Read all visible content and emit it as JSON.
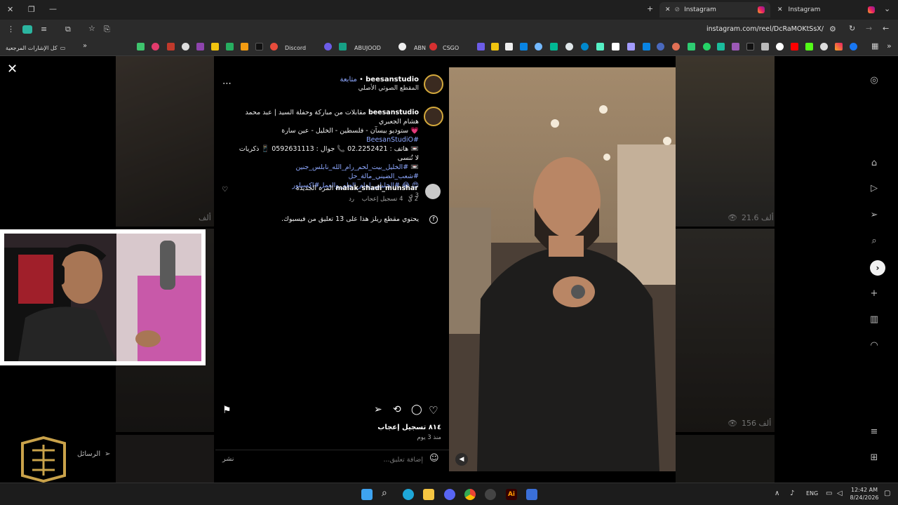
{
  "browser": {
    "tabs": [
      {
        "title": "Instagram",
        "active": true
      },
      {
        "title": "Instagram",
        "active": false
      }
    ],
    "url": "instagram.com/reel/DcRaMOKtSsX/",
    "bookmarks": {
      "all_label": "كل الإشارات المرجعية",
      "items": [
        "Discord",
        "ABUJOOD",
        "ABN",
        "CSGO"
      ]
    }
  },
  "post": {
    "username": "beesanstudio",
    "follow_label": "متابعة",
    "audio": "المقطع الصوتي الأصلي",
    "caption_user": "beesanstudio",
    "caption_text": "مقابلات من مباركة وحفلة السيد | عبد محمد هشام الجعبري",
    "caption_line2_tag": "#BeesanStudiO",
    "caption_line2": "💗 ستوديو بيسآن - فلسطين - الخليل - عين سارة",
    "caption_line3": "📼 هاتف : 02.2252421 📞 جوال : 0592631113 📱 ذكريات لا تُنسى",
    "caption_line4": "📼 #الخليل_بيت_لحم_رام_الله_نابلس_جنين #شعب_الضيني_مالة_حل",
    "caption_line5": "😍 😂 #الخليلي_إمام_العلم_والعمل#اكسبلور",
    "caption_time": "3 ي",
    "comment": {
      "user": "malak_shadi_munshar",
      "text": "المره الجديده",
      "time": "2 ي",
      "likes": "4 تسجيل إعجاب",
      "reply": "رد"
    },
    "facebook_note": "يحتوي مقطع ريلز هذا على 13 تعليق من فيسبوك.",
    "likes": "٨١٤ تسجيل إعجاب",
    "posted": "منذ 3 يوم",
    "add_comment_placeholder": "إضافة تعليق...",
    "post_button": "نشر"
  },
  "background": {
    "views": [
      "21.6 ألف",
      "156 ألف"
    ],
    "partial_view": "ألف"
  },
  "messages_label": "الرسائل",
  "taskbar": {
    "lang": "ENG",
    "time": "12:42 AM",
    "date": "8/24/2026"
  },
  "colors": {
    "accent_link": "#8ea8ff",
    "chrome_dark": "#1f1f1f"
  }
}
